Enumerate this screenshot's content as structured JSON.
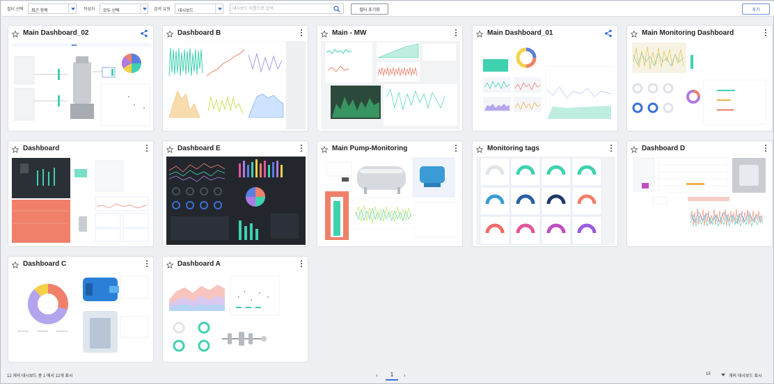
{
  "toolbar": {
    "filter_label": "필터 선택",
    "filter_value": "최근 항목",
    "author_label": "작성자",
    "author_value": "모두 선택",
    "search_type_label": "검색 유형",
    "search_type_value": "대시보드",
    "search_placeholder": "대시보드 이름으로 검색",
    "reset_label": "필터 초기화",
    "add_label": "추가"
  },
  "cards": [
    {
      "title": "Main Dashboard_02",
      "action_icon": "share-icon"
    },
    {
      "title": "Dashboard B",
      "action_icon": "kebab-menu-icon"
    },
    {
      "title": "Main - MW",
      "action_icon": "kebab-menu-icon"
    },
    {
      "title": "Main Dashboard_01",
      "action_icon": "share-icon"
    },
    {
      "title": "Main Monitoring Dashboard",
      "action_icon": "kebab-menu-icon"
    },
    {
      "title": "Dashboard",
      "action_icon": "kebab-menu-icon"
    },
    {
      "title": "Dashboard E",
      "action_icon": "kebab-menu-icon"
    },
    {
      "title": "Main Pump-Monitoring",
      "action_icon": "kebab-menu-icon"
    },
    {
      "title": "Monitoring tags",
      "action_icon": "kebab-menu-icon"
    },
    {
      "title": "Dashboard D",
      "action_icon": "kebab-menu-icon"
    },
    {
      "title": "Dashboard C",
      "action_icon": "kebab-menu-icon"
    },
    {
      "title": "Dashboard A",
      "action_icon": "kebab-menu-icon"
    }
  ],
  "footer": {
    "summary": "12 개의 대시보드 중 1 에서 12개 표시",
    "page_prev": "‹",
    "page_current": "1",
    "page_next": "›",
    "page_size": "15",
    "page_size_label": "개의 대시보드 표시"
  },
  "colors": {
    "accent": "#3b6fd6",
    "teal": "#3fd1b0",
    "salmon": "#f0806a",
    "dark_panel": "#2b2f36"
  }
}
